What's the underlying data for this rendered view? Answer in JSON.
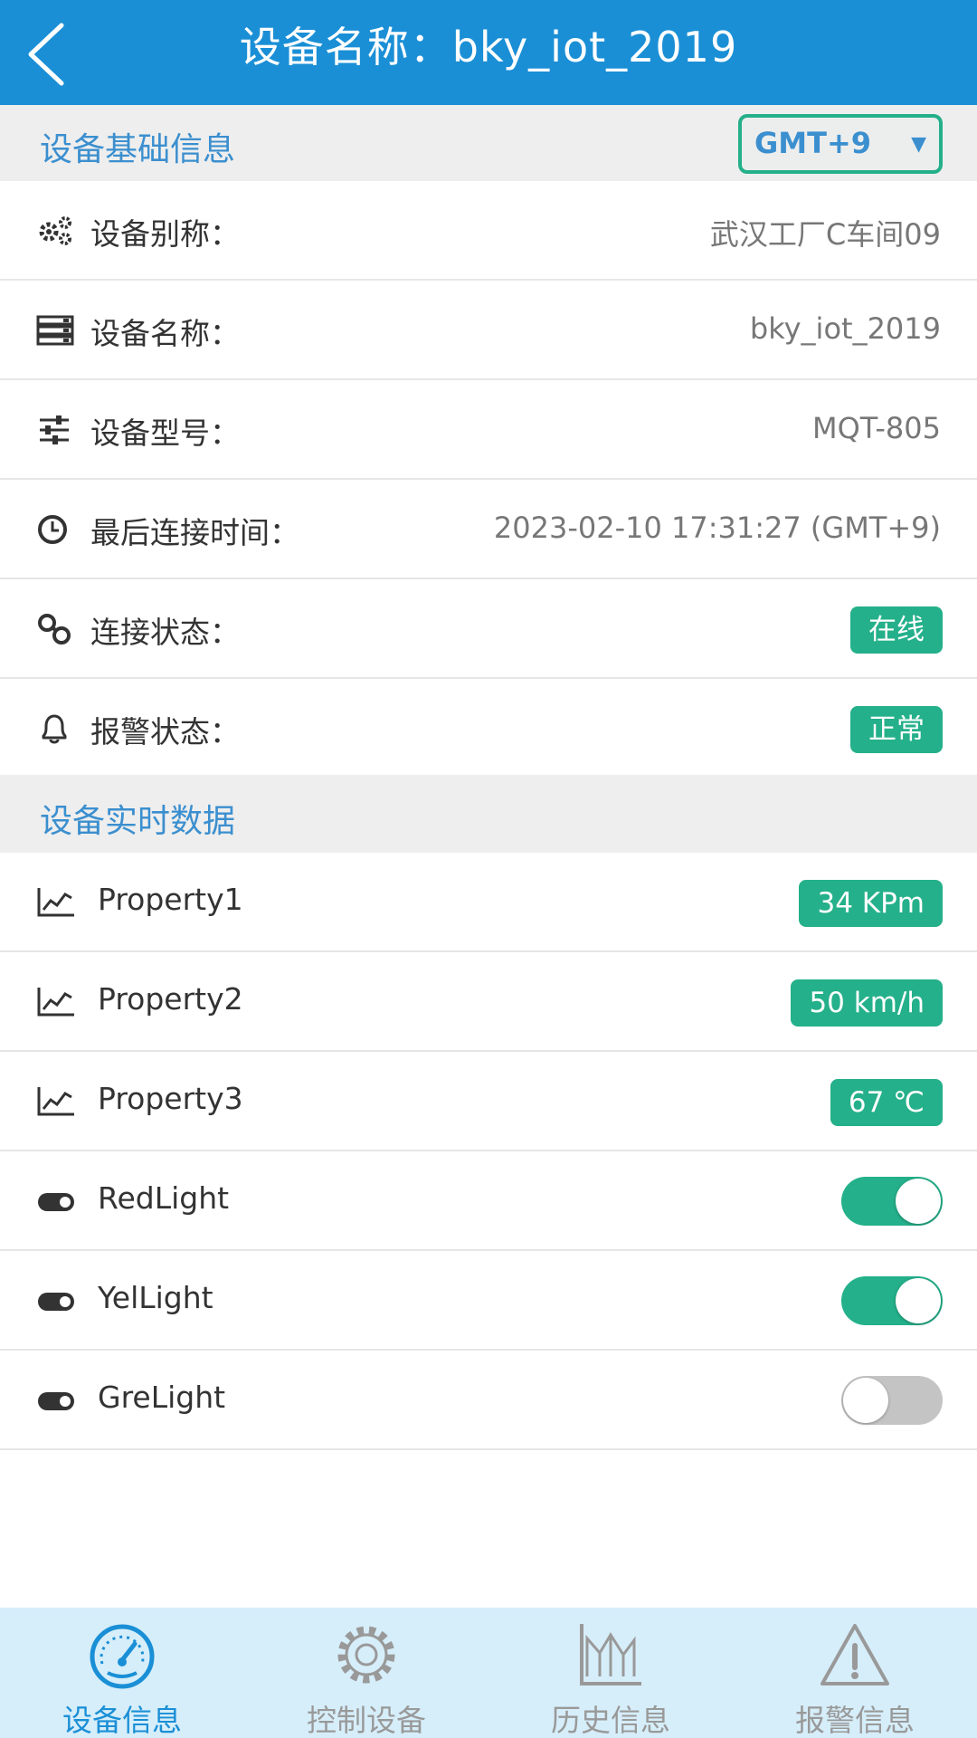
{
  "header": {
    "title": "设备名称：bky_iot_2019",
    "back_icon": "chevron-left-icon"
  },
  "basic_info": {
    "title": "设备基础信息",
    "timezone": {
      "value": "GMT+9",
      "caret": "▼"
    },
    "rows": [
      {
        "icon": "cogs-icon",
        "label": "设备别称：",
        "value": "武汉工厂C车间09"
      },
      {
        "icon": "server-icon",
        "label": "设备名称：",
        "value": "bky_iot_2019"
      },
      {
        "icon": "sliders-icon",
        "label": "设备型号：",
        "value": "MQT-805"
      },
      {
        "icon": "clock-icon",
        "label": "最后连接时间：",
        "value": "2023-02-10 17:31:27 (GMT+9)"
      }
    ],
    "connection": {
      "icon": "link-icon",
      "label": "连接状态：",
      "badge": "在线"
    },
    "alarm": {
      "icon": "bell-icon",
      "label": "报警状态：",
      "badge": "正常"
    }
  },
  "realtime": {
    "title": "设备实时数据",
    "properties": [
      {
        "icon": "line-chart-icon",
        "label": "Property1",
        "value": "34 KPm"
      },
      {
        "icon": "line-chart-icon",
        "label": "Property2",
        "value": "50 km/h"
      },
      {
        "icon": "line-chart-icon",
        "label": "Property3",
        "value": "67 ℃"
      }
    ],
    "switches": [
      {
        "icon": "toggle-icon",
        "label": "RedLight",
        "on": true
      },
      {
        "icon": "toggle-icon",
        "label": "YelLight",
        "on": true
      },
      {
        "icon": "toggle-icon",
        "label": "GreLight",
        "on": false
      }
    ]
  },
  "bottom_nav": {
    "items": [
      {
        "icon": "dashboard-icon",
        "label": "设备信息",
        "active": true
      },
      {
        "icon": "gear-icon",
        "label": "控制设备",
        "active": false
      },
      {
        "icon": "history-chart-icon",
        "label": "历史信息",
        "active": false
      },
      {
        "icon": "warning-icon",
        "label": "报警信息",
        "active": false
      }
    ]
  },
  "colors": {
    "header_bg": "#1a8fd6",
    "accent_green": "#24b08a",
    "section_title": "#3b8fcf",
    "nav_bg": "#d6eefa"
  }
}
